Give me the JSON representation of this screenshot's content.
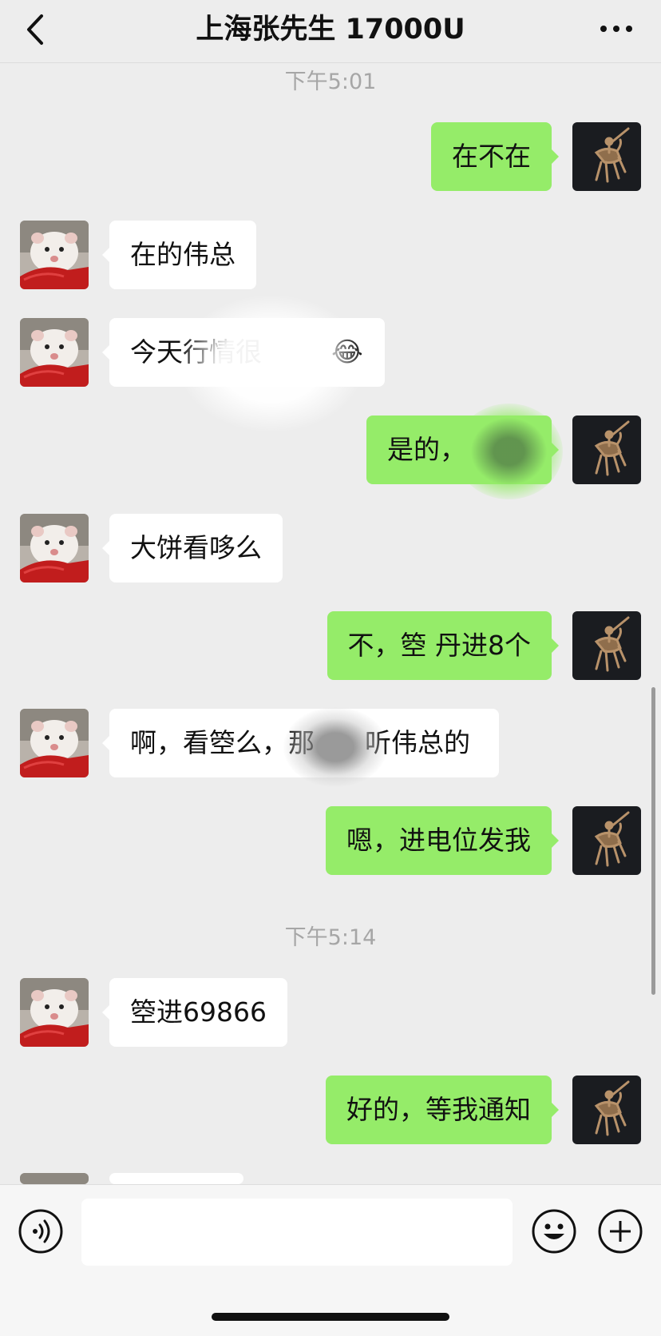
{
  "header": {
    "title": "上海张先生 17000U"
  },
  "timestamps": [
    "下午5:01",
    "下午5:14"
  ],
  "messages": [
    {
      "side": "right",
      "text": "在不在"
    },
    {
      "side": "left",
      "text": "在的伟总"
    },
    {
      "side": "left",
      "text": "今天行情很",
      "emoji": "😂"
    },
    {
      "side": "right",
      "text": "是的，"
    },
    {
      "side": "left",
      "text": "大饼看哆么"
    },
    {
      "side": "right",
      "text": "不，箜 丹进8个"
    },
    {
      "side": "left",
      "text": "啊，看箜么，那",
      "text_tail": "听伟总的"
    },
    {
      "side": "right",
      "text": "嗯，进电位发我"
    },
    {
      "side": "left",
      "text": "箜进69866"
    },
    {
      "side": "right",
      "text": "好的，等我通知"
    }
  ],
  "icons": {
    "back": "chevron-left-icon",
    "more": "more-dots-icon",
    "voice": "voice-icon",
    "emoji": "emoji-icon",
    "plus": "plus-icon"
  },
  "colors": {
    "background": "#ededed",
    "sent_bubble": "#95ec69",
    "received_bubble": "#ffffff",
    "timestamp": "#a6a6a6"
  }
}
